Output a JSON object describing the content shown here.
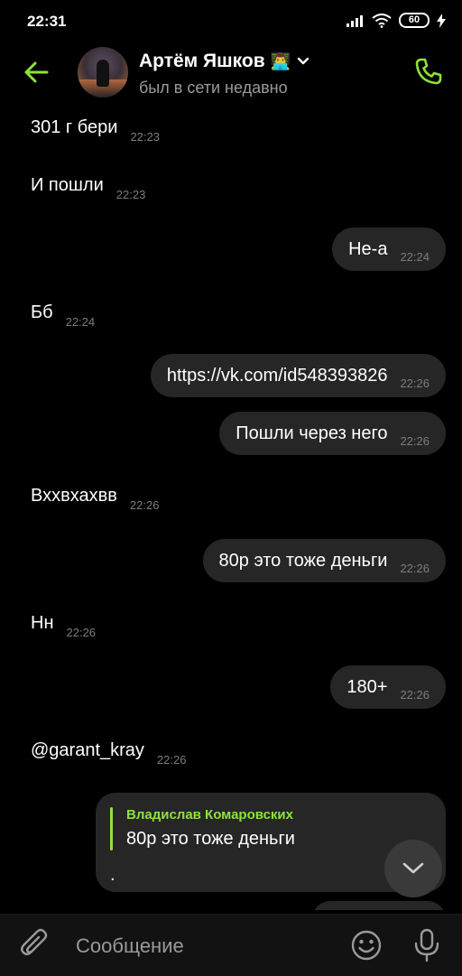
{
  "status_bar": {
    "time": "22:31",
    "battery": "60"
  },
  "header": {
    "contact_name": "Артём Яшков",
    "name_emoji": "👨‍💻",
    "status": "был в сети недавно"
  },
  "messages": [
    {
      "text": "301 г бери",
      "time": "22:23",
      "direction": "in"
    },
    {
      "text": "И пошли",
      "time": "22:23",
      "direction": "in"
    },
    {
      "text": "Не-а",
      "time": "22:24",
      "direction": "out"
    },
    {
      "text": "Бб",
      "time": "22:24",
      "direction": "in"
    },
    {
      "text": "https://vk.com/id548393826",
      "time": "22:26",
      "direction": "out",
      "is_link": true
    },
    {
      "text": "Пошли через него",
      "time": "22:26",
      "direction": "out"
    },
    {
      "text": "Вххвхахвв",
      "time": "22:26",
      "direction": "in"
    },
    {
      "text": "80р это тоже деньги",
      "time": "22:26",
      "direction": "out"
    },
    {
      "text": "Нн",
      "time": "22:26",
      "direction": "in"
    },
    {
      "text": "180+",
      "time": "22:26",
      "direction": "out"
    },
    {
      "text": "@garant_kray",
      "time": "22:26",
      "direction": "in",
      "is_link": true
    }
  ],
  "reply": {
    "author": "Владислав Комаровских",
    "quoted_text": "80р это тоже деньги",
    "text": "."
  },
  "composer": {
    "placeholder": "Сообщение"
  },
  "colors": {
    "accent": "#8ee23a",
    "bubble": "#262626",
    "background": "#000000"
  },
  "icons": [
    "back-arrow-icon",
    "chevron-down-icon",
    "phone-icon",
    "paperclip-icon",
    "emoji-icon",
    "microphone-icon",
    "chevron-down-icon"
  ]
}
